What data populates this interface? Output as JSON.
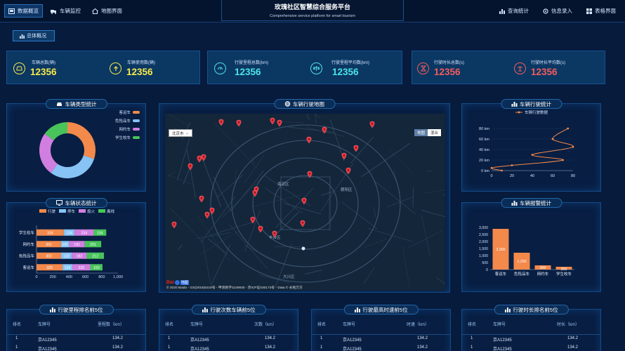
{
  "nav": {
    "left": [
      {
        "label": "数据概览",
        "icon": "dashboard-icon",
        "active": true
      },
      {
        "label": "车辆监控",
        "icon": "truck-icon",
        "active": false
      },
      {
        "label": "地图界面",
        "icon": "home-icon",
        "active": false
      }
    ],
    "right": [
      {
        "label": "查询统计",
        "icon": "bar-chart-icon"
      },
      {
        "label": "信息录入",
        "icon": "gear-icon"
      },
      {
        "label": "表格界面",
        "icon": "grid-icon"
      }
    ]
  },
  "header": {
    "title": "玫瑰社区智慧综合服务平台",
    "subtitle": "Comprehensive service platform for smart tourism"
  },
  "overview_button": "总体概况",
  "stats": [
    {
      "label": "车辆总数(辆)",
      "value": "12356",
      "icon": "car-icon",
      "color": "#f6e94a"
    },
    {
      "label": "车辆使用数(辆)",
      "value": "12356",
      "icon": "arrow-up-icon",
      "color": "#f6e94a"
    },
    {
      "label": "行驶里程总数(km)",
      "value": "12356",
      "icon": "gauge-icon",
      "color": "#4de3e9"
    },
    {
      "label": "行驶里程平均数(km)",
      "value": "12356",
      "icon": "scale-icon",
      "color": "#4de3e9"
    },
    {
      "label": "行驶时长总数(s)",
      "value": "12356",
      "icon": "hourglass-icon",
      "color": "#f25c5c"
    },
    {
      "label": "行驶时长平均数(s)",
      "value": "12356",
      "icon": "balance-icon",
      "color": "#f25c5c"
    }
  ],
  "vehicle_types": {
    "title": "车辆类型统计",
    "chart_data": {
      "type": "pie",
      "labels": [
        "客运车",
        "危险品车",
        "网约车",
        "学生校车"
      ],
      "values": [
        30,
        30,
        25,
        15
      ],
      "colors": [
        "#f3894b",
        "#87c3f4",
        "#d07ee0",
        "#48c45a"
      ]
    }
  },
  "vehicle_status": {
    "title": "车辆状态统计",
    "chart_data": {
      "type": "bar",
      "orientation": "horizontal",
      "stacked": true,
      "categories": [
        "客运车",
        "危险品车",
        "网约车",
        "学生校车"
      ],
      "series": [
        {
          "name": "行驶",
          "color": "#f3894b",
          "values": [
            320,
            302,
            301,
            334
          ]
        },
        {
          "name": "停车",
          "color": "#87c3f4",
          "values": [
            120,
            132,
            101,
            134
          ]
        },
        {
          "name": "熄火",
          "color": "#d07ee0",
          "values": [
            220,
            182,
            191,
            234
          ]
        },
        {
          "name": "离线",
          "color": "#48c45a",
          "values": [
            150,
            212,
            201,
            154
          ]
        }
      ],
      "xticks": [
        "0",
        "200",
        "400",
        "600",
        "800",
        "1,000"
      ],
      "xlim": [
        0,
        1000
      ]
    }
  },
  "map": {
    "title": "车辆行驶地图",
    "city_label": "北京市",
    "map_type_options": [
      "地图",
      "混合"
    ],
    "copyright": "© 2020 Baidu - GS(2019)5218号 - 甲测资字1100930 - 京ICP证030173号 - Data © 长地万方",
    "logo_text": "Bai",
    "logo_text2": "地图",
    "district_labels": [
      "海淀区",
      "朝阳区",
      "丰台区",
      "大兴区"
    ]
  },
  "vehicle_trip": {
    "title": "车辆行驶统计",
    "legend": "车辆行驶数据",
    "chart_data": {
      "type": "line",
      "x": [
        10,
        0,
        20,
        70,
        40,
        80,
        60,
        75
      ],
      "y": [
        0,
        5,
        10,
        20,
        30,
        45,
        60,
        80
      ],
      "xticks": [
        "0",
        "20",
        "40",
        "60",
        "80"
      ],
      "yticks": [
        "0 km",
        "20 km",
        "40 km",
        "60 km",
        "80 km"
      ],
      "xlim": [
        0,
        80
      ],
      "ylim": [
        0,
        80
      ]
    }
  },
  "alarm": {
    "title": "车辆报警统计",
    "chart_data": {
      "type": "bar",
      "categories": [
        "客运车",
        "危险品车",
        "网约车",
        "学生校车"
      ],
      "values": [
        2900,
        1200,
        300,
        200
      ],
      "value_labels": [
        "2,900",
        "1,200",
        "300",
        "200"
      ],
      "yticks": [
        "0",
        "500",
        "1,000",
        "1,500",
        "2,000",
        "2,500",
        "3,000"
      ],
      "ylim": [
        0,
        3000
      ],
      "color": "#f3894b"
    }
  },
  "tables": [
    {
      "title": "行驶里程排名前5位",
      "headers": [
        "排名",
        "车牌号",
        "里程数（km）"
      ],
      "rows": [
        [
          "1",
          "京A12345",
          "134.2"
        ],
        [
          "1",
          "京A12345",
          "134.2"
        ]
      ]
    },
    {
      "title": "行驶次数车辆前5位",
      "headers": [
        "排名",
        "车牌号",
        "次数（km）"
      ],
      "rows": [
        [
          "1",
          "京A12345",
          "134.2"
        ],
        [
          "1",
          "京A12345",
          "134.2"
        ]
      ]
    },
    {
      "title": "行驶最高时速前5位",
      "headers": [
        "排名",
        "车牌号",
        "时速（km）"
      ],
      "rows": [
        [
          "1",
          "京A12345",
          "134.2"
        ],
        [
          "1",
          "京A12345",
          "134.2"
        ]
      ]
    },
    {
      "title": "行驶时长排名前5位",
      "headers": [
        "排名",
        "车牌号",
        "时长（km）"
      ],
      "rows": [
        [
          "1",
          "京A12345",
          "134.2"
        ],
        [
          "1",
          "京A12345",
          "134.2"
        ]
      ]
    }
  ]
}
